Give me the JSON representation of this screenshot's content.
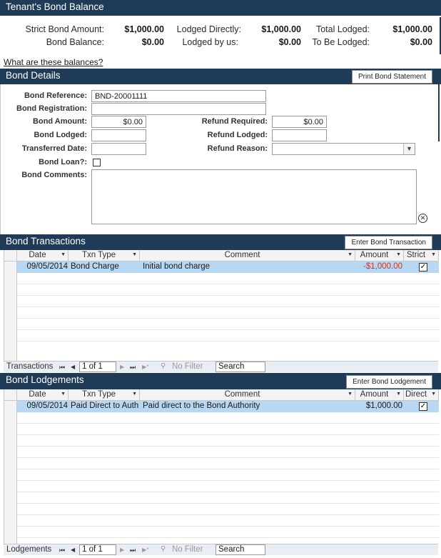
{
  "top_header": {
    "title": "Tenant's Bond Balance"
  },
  "summary": {
    "strict_bond_amount_label": "Strict Bond Amount:",
    "strict_bond_amount_value": "$1,000.00",
    "bond_balance_label": "Bond Balance:",
    "bond_balance_value": "$0.00",
    "lodged_directly_label": "Lodged Directly:",
    "lodged_directly_value": "$1,000.00",
    "lodged_by_us_label": "Lodged by us:",
    "lodged_by_us_value": "$0.00",
    "total_lodged_label": "Total Lodged:",
    "total_lodged_value": "$1,000.00",
    "to_be_lodged_label": "To Be Lodged:",
    "to_be_lodged_value": "$0.00"
  },
  "balances_link": "What are these balances?",
  "bond_details": {
    "title": "Bond Details",
    "print_button": "Print Bond Statement",
    "bond_reference_label": "Bond Reference:",
    "bond_reference_value": "BND-20001111",
    "bond_registration_label": "Bond Registration:",
    "bond_registration_value": "",
    "bond_amount_label": "Bond Amount:",
    "bond_amount_value": "$0.00",
    "bond_lodged_label": "Bond Lodged:",
    "bond_lodged_value": "",
    "transferred_date_label": "Transferred Date:",
    "transferred_date_value": "",
    "bond_loan_label": "Bond Loan?:",
    "bond_comments_label": "Bond Comments:",
    "bond_comments_value": "",
    "refund_required_label": "Refund Required:",
    "refund_required_value": "$0.00",
    "refund_lodged_label": "Refund Lodged:",
    "refund_lodged_value": "",
    "refund_reason_label": "Refund Reason:",
    "refund_reason_value": ""
  },
  "transactions": {
    "title": "Bond Transactions",
    "enter_button": "Enter Bond Transaction",
    "columns": [
      "Date",
      "Txn Type",
      "Comment",
      "Amount",
      "Strict"
    ],
    "rows": [
      {
        "date": "09/05/2014",
        "txn_type": "Bond Charge",
        "comment": "Initial bond charge",
        "amount": "-$1,000.00",
        "strict": true
      }
    ],
    "nav": {
      "label": "Transactions",
      "first": "⏮",
      "prev": "◀",
      "record": "1 of 1",
      "next": "▶",
      "last": "⏭",
      "new": "▶*",
      "filter": "No Filter",
      "search": "Search"
    }
  },
  "lodgements": {
    "title": "Bond Lodgements",
    "enter_button": "Enter Bond Lodgement",
    "columns": [
      "Date",
      "Txn Type",
      "Comment",
      "Amount",
      "Direct"
    ],
    "rows": [
      {
        "date": "09/05/2014",
        "txn_type": "Paid Direct to Auth",
        "comment": "Paid direct to the Bond Authority",
        "amount": "$1,000.00",
        "direct": true
      }
    ],
    "nav": {
      "label": "Lodgements",
      "first": "⏮",
      "prev": "◀",
      "record": "1 of 1",
      "next": "▶",
      "last": "⏭",
      "new": "▶*",
      "filter": "No Filter",
      "search": "Search"
    }
  },
  "colors": {
    "header_bg": "#1f3b56",
    "row_selected": "#b8d7f2",
    "negative": "#c0392b"
  }
}
